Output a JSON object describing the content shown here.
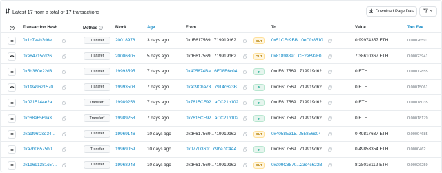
{
  "header": {
    "summary": "Latest 17 from a total of 17 transactions",
    "download_label": "Download Page Data"
  },
  "columns": {
    "hash": "Transaction Hash",
    "method": "Method",
    "block": "Block",
    "age": "Age",
    "from": "From",
    "to": "To",
    "value": "Value",
    "fee": "Txn Fee"
  },
  "rows": [
    {
      "hash": "0x1c7eab3d6e...",
      "method": "Transfer",
      "block": "20018976",
      "age": "3 days ago",
      "from": "0xdF617569...719919d62",
      "dir": "OUT",
      "to": "0x51CFd9BB...0eCfb8510",
      "value": "0.99974357 ETH",
      "fee": "0.00026591"
    },
    {
      "hash": "0xe84715cd26...",
      "method": "Transfer",
      "block": "20006305",
      "age": "5 days ago",
      "from": "0xdF617569...719919d62",
      "dir": "OUT",
      "to": "0x818988ef...CF2e692F0",
      "value": "7.38610367 ETH",
      "fee": "0.00023941"
    },
    {
      "hash": "0x5b380e22d3...",
      "method": "Transfer",
      "block": "19993595",
      "age": "7 days ago",
      "from": "0x405874Ba...6E08E6c04",
      "dir": "IN",
      "to": "0xdF617569...719919d62",
      "value": "0 ETH",
      "fee": "0.00012855"
    },
    {
      "hash": "0x1f849621570...",
      "method": "Transfer",
      "block": "19993508",
      "age": "7 days ago",
      "from": "0xa09Cba73...7914c623B",
      "dir": "IN",
      "to": "0xdF617569...719919d62",
      "value": "0 ETH",
      "fee": "0.00015061"
    },
    {
      "hash": "0x0215144e2a...",
      "method": "Transfer*",
      "block": "19989258",
      "age": "7 days ago",
      "from": "0x7615CF92...aCC21b102",
      "dir": "IN",
      "to": "0xdF617569...719919d62",
      "value": "0 ETH",
      "fee": "0.00018035"
    },
    {
      "hash": "0xc68e6569a3...",
      "method": "Transfer*",
      "block": "19989258",
      "age": "7 days ago",
      "from": "0x7615CF92...aCC21b102",
      "dir": "IN",
      "to": "0xdF617569...719919d62",
      "value": "0 ETH",
      "fee": "0.00018179"
    },
    {
      "hash": "0xacf96f2cd34...",
      "method": "Transfer",
      "block": "19969146",
      "age": "10 days ago",
      "from": "0xdF617569...719919d62",
      "dir": "OUT",
      "to": "0x4058E315...f558E6c04",
      "value": "0.49817637 ETH",
      "fee": "0.00004685"
    },
    {
      "hash": "0xa7b06575b0...",
      "method": "Transfer",
      "block": "19969059",
      "age": "10 days ago",
      "from": "0x077D360f...c9be7C4A4",
      "dir": "IN",
      "to": "0xdF617569...719919d62",
      "value": "0.49853354 ETH",
      "fee": "0.0000462"
    },
    {
      "hash": "0x1d691381c5f...",
      "method": "Transfer",
      "block": "19968948",
      "age": "10 days ago",
      "from": "0xdF617569...719919d62",
      "dir": "OUT",
      "to": "0xa09C8870...23c4c623B",
      "value": "8.28016112 ETH",
      "fee": "0.00026259"
    }
  ]
}
